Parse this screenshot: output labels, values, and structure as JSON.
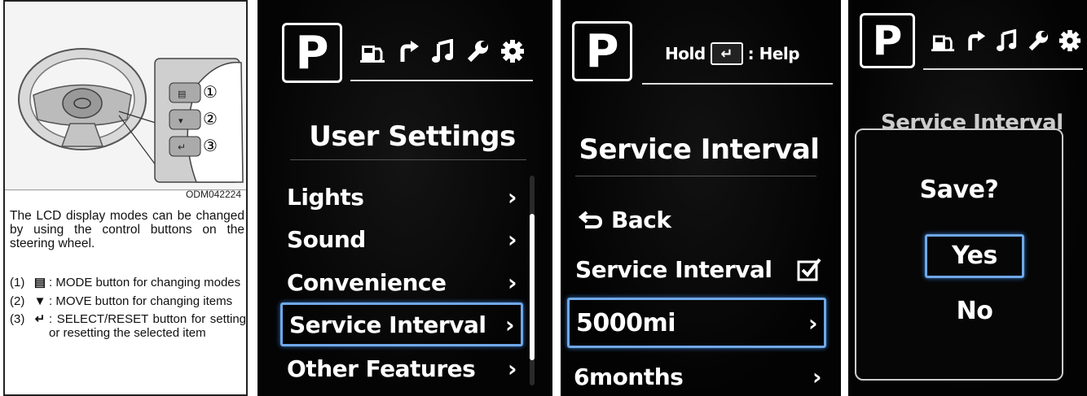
{
  "manual": {
    "figure_code": "ODM042224",
    "callouts": [
      "①",
      "②",
      "③"
    ],
    "paragraph": "The LCD display modes can be changed by using the control buttons on the steering wheel.",
    "items": [
      {
        "num": "(1)",
        "symbol": "▤",
        "text": ": MODE button for changing modes"
      },
      {
        "num": "(2)",
        "symbol": "▼",
        "text": ": MOVE button  for changing items"
      },
      {
        "num": "(3)",
        "symbol": "↵",
        "text": ": SELECT/RESET button for setting or resetting the selected item"
      }
    ]
  },
  "screen1": {
    "gear": "P",
    "title": "User Settings",
    "menu": [
      {
        "label": "Lights",
        "chevron": "›"
      },
      {
        "label": "Sound",
        "chevron": "›"
      },
      {
        "label": "Convenience",
        "chevron": "›"
      },
      {
        "label": "Service Interval",
        "chevron": "›",
        "selected": true
      },
      {
        "label": "Other Features",
        "chevron": "›"
      }
    ],
    "icons": [
      "fuel-icon",
      "turn-arrow-icon",
      "music-note-icon",
      "wrench-icon",
      "gear-icon"
    ],
    "scroll_position": 0.6
  },
  "screen2": {
    "gear": "P",
    "hint_prefix": "Hold",
    "hint_key": "↵",
    "hint_suffix": ": Help",
    "title": "Service Interval",
    "back_label": "Back",
    "toggle_label": "Service Interval",
    "toggle_checked": true,
    "rows": [
      {
        "label": "5000mi",
        "chevron": "›",
        "selected": true
      },
      {
        "label": "6months",
        "chevron": "›"
      }
    ]
  },
  "screen3": {
    "gear": "P",
    "bg_title": "Service Interval",
    "dialog_title": "Save?",
    "options": [
      {
        "label": "Yes",
        "selected": true
      },
      {
        "label": "No"
      }
    ]
  }
}
